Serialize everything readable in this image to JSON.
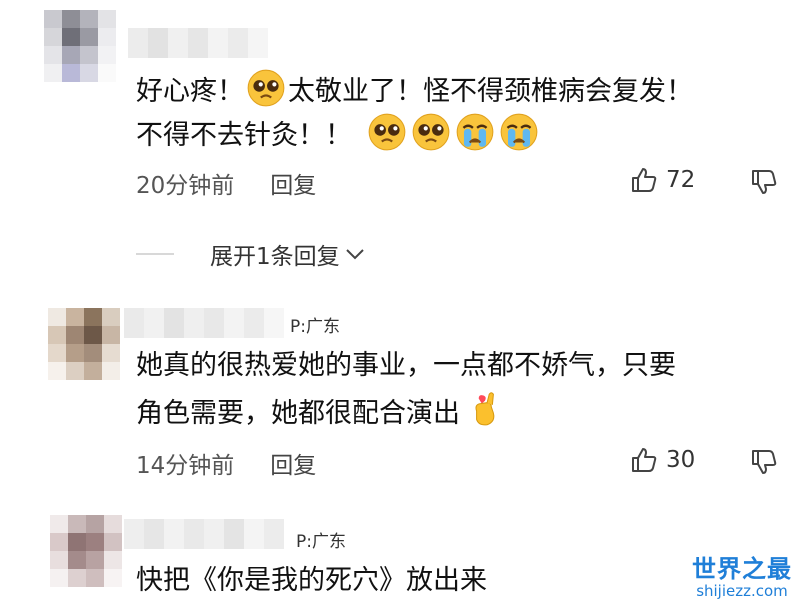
{
  "comments": [
    {
      "location": "",
      "text_line1_a": "好心疼！",
      "text_line1_b": "太敬业了！怪不得颈椎病会复发！",
      "text_line2": "不得不去针灸！！",
      "time": "20分钟前",
      "reply": "回复",
      "likes": "72"
    },
    {
      "location": "P:广东",
      "text_line1": "她真的很热爱她的事业，一点都不娇气，只要",
      "text_line2": "角色需要，她都很配合演出",
      "time": "14分钟前",
      "reply": "回复",
      "likes": "30"
    },
    {
      "location": "P:广东",
      "text_line1": "快把《你是我的死穴》放出来"
    }
  ],
  "expand_replies": "展开1条回复",
  "icons": {
    "like": "thumbs-up-icon",
    "dislike": "thumbs-down-icon",
    "expand": "chevron-down-icon",
    "pleading": "pleading-face-emoji",
    "crying": "crying-face-emoji",
    "heart_hand": "finger-heart-emoji"
  },
  "watermark": {
    "title": "世界之最",
    "url": "shijiezz.com"
  },
  "colors": {
    "watermark": "#1f7fd8",
    "meta": "#555555",
    "divider": "#d8d8d8"
  }
}
